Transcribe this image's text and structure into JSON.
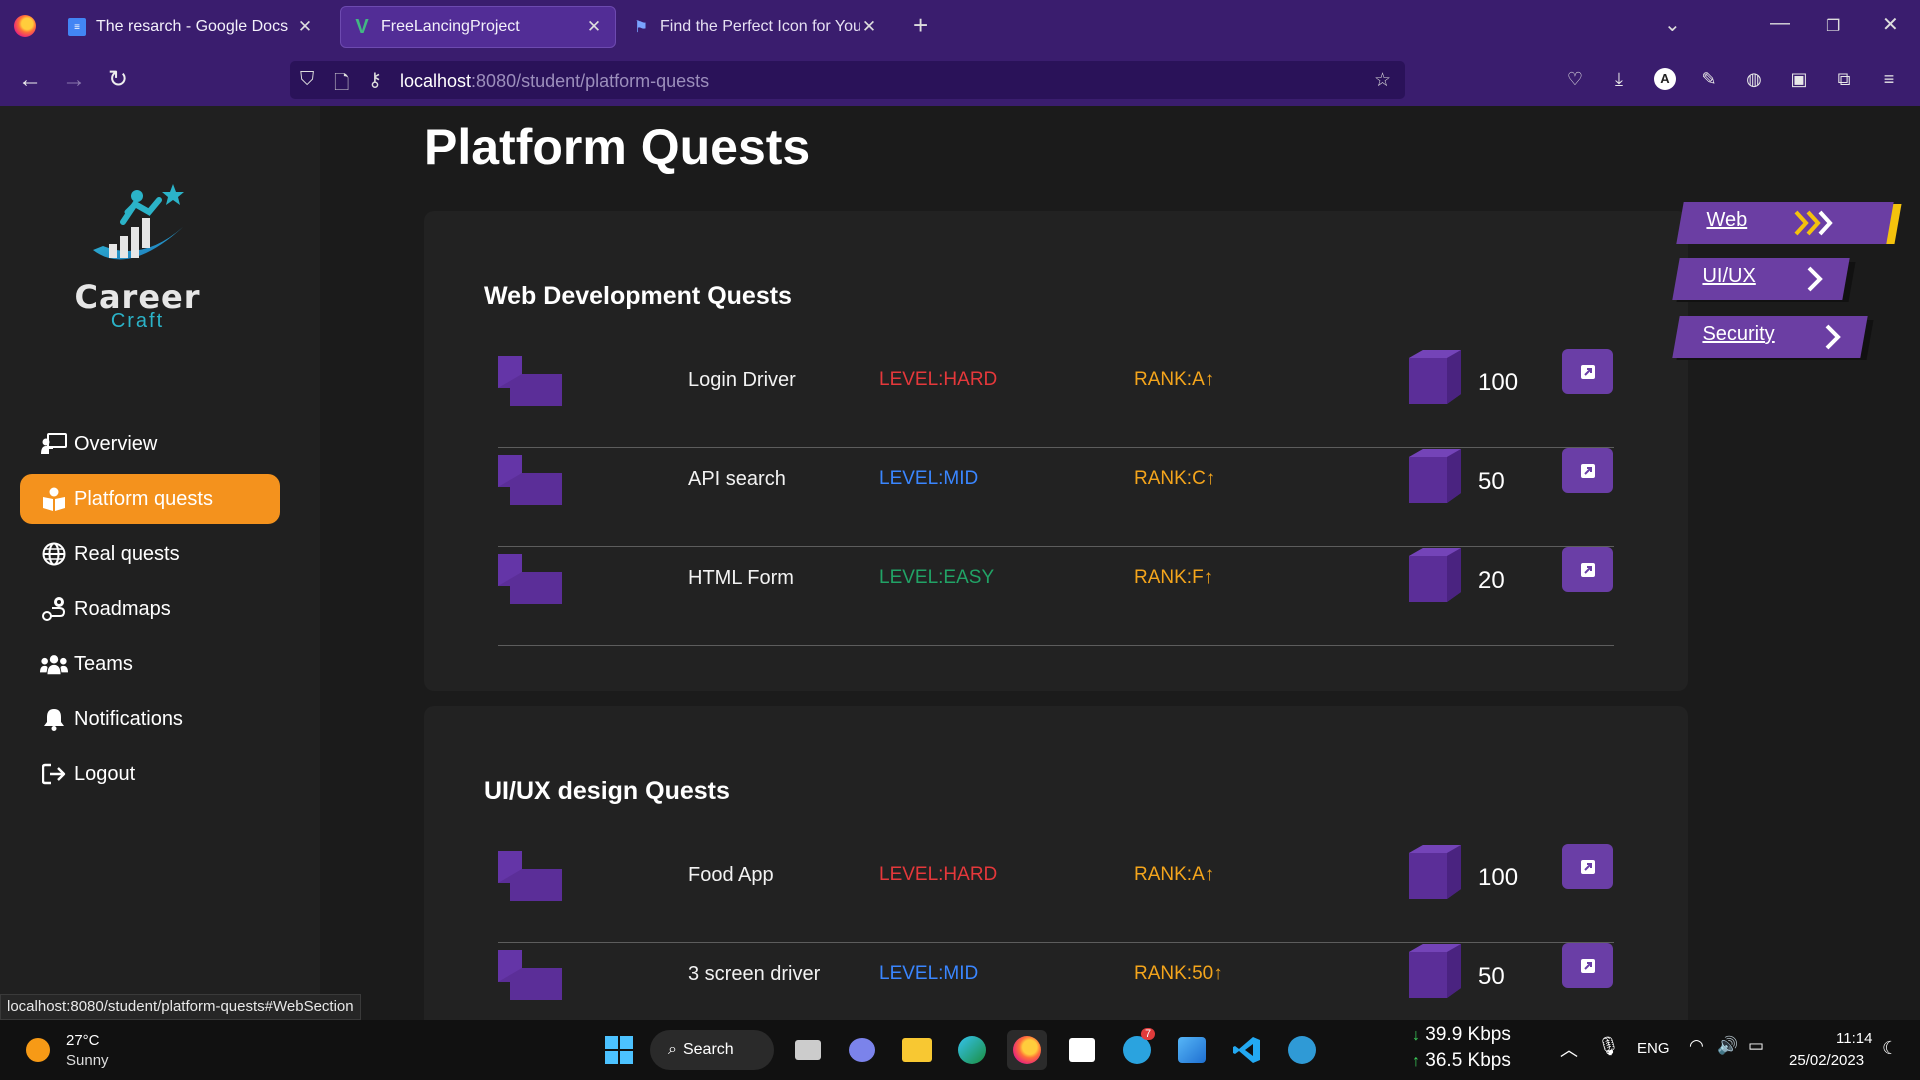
{
  "browser": {
    "tabs": [
      {
        "title": "The resarch - Google Docs",
        "icon": "google-docs-icon"
      },
      {
        "title": "FreeLancingProject",
        "icon": "vue-icon"
      },
      {
        "title": "Find the Perfect Icon for Your Pr",
        "icon": "flag-icon"
      }
    ],
    "url_host": "localhost",
    "url_rest": ":8080/student/platform-quests"
  },
  "sidebar": {
    "logo_title": "Career",
    "logo_subtitle": "Craft",
    "items": [
      {
        "label": "Overview",
        "icon": "presentation-icon"
      },
      {
        "label": "Platform quests",
        "icon": "book-reader-icon"
      },
      {
        "label": "Real quests",
        "icon": "globe-icon"
      },
      {
        "label": "Roadmaps",
        "icon": "route-icon"
      },
      {
        "label": "Teams",
        "icon": "users-icon"
      },
      {
        "label": "Notifications",
        "icon": "bell-icon"
      },
      {
        "label": "Logout",
        "icon": "logout-icon"
      }
    ]
  },
  "page": {
    "title": "Platform Quests"
  },
  "sections": [
    {
      "title": "Web Development Quests",
      "quests": [
        {
          "name": "Login Driver",
          "level": "LEVEL:HARD",
          "level_color": "#e5383b",
          "rank": "RANK:A↑",
          "points": "100"
        },
        {
          "name": "API search",
          "level": "LEVEL:MID",
          "level_color": "#3a86ff",
          "rank": "RANK:C↑",
          "points": "50"
        },
        {
          "name": "HTML Form",
          "level": "LEVEL:EASY",
          "level_color": "#21a366",
          "rank": "RANK:F↑",
          "points": "20"
        }
      ]
    },
    {
      "title": "UI/UX design Quests",
      "quests": [
        {
          "name": "Food App",
          "level": "LEVEL:HARD",
          "level_color": "#e5383b",
          "rank": "RANK:A↑",
          "points": "100"
        },
        {
          "name": "3 screen driver",
          "level": "LEVEL:MID",
          "level_color": "#3a86ff",
          "rank": "RANK:50↑",
          "points": "50"
        }
      ]
    }
  ],
  "section_nav": [
    {
      "label": "Web",
      "active": true
    },
    {
      "label": "UI/UX",
      "active": false
    },
    {
      "label": "Security",
      "active": false
    }
  ],
  "status_url": "localhost:8080/student/platform-quests#WebSection",
  "taskbar": {
    "weather_temp": "27°C",
    "weather_desc": "Sunny",
    "search_label": "Search",
    "telegram_badge": "7",
    "net_down": "39.9 Kbps",
    "net_up": "36.5 Kbps",
    "language": "ENG",
    "time": "11:14",
    "date": "25/02/2023"
  },
  "colors": {
    "accent": "#f4921d",
    "purple": "#6b3ea3",
    "rank": "#f4a51c"
  }
}
